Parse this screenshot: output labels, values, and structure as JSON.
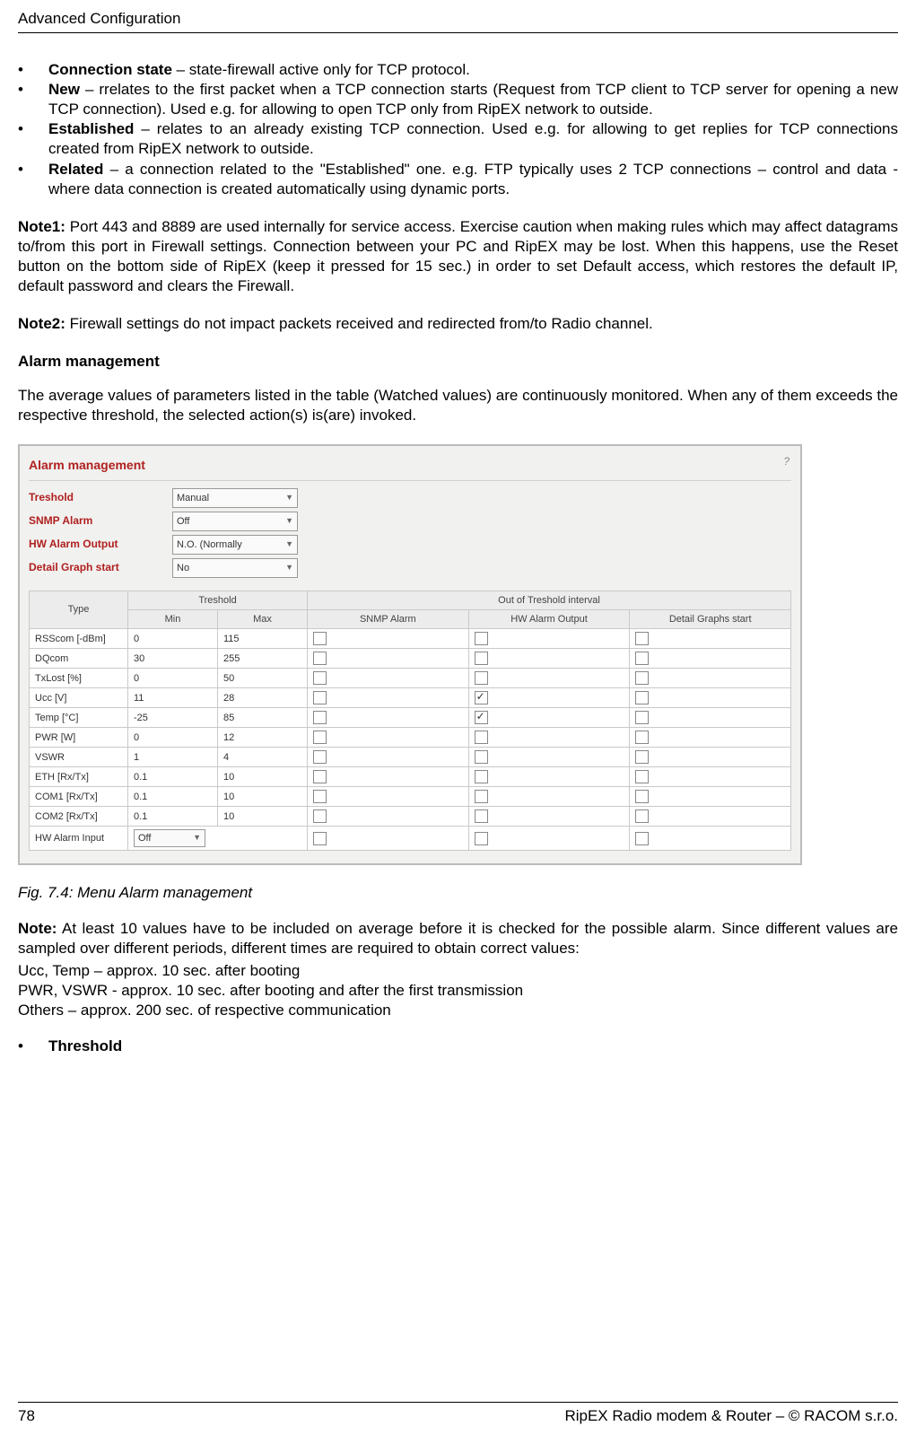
{
  "header": "Advanced Configuration",
  "bullets": [
    {
      "term": "Connection state",
      "desc": " – state-firewall active only for TCP protocol."
    },
    {
      "term": "New",
      "desc": " – rrelates to the first packet when a TCP connection starts (Request from TCP client to TCP server for opening a new TCP connection). Used e.g. for allowing to open TCP only from RipEX network to outside."
    },
    {
      "term": "Established",
      "desc": " – relates to an already existing TCP connection. Used e.g. for allowing to get replies for TCP connections created from RipEX network to outside."
    },
    {
      "term": "Related",
      "desc": " – a connection related to the \"Established\" one. e.g. FTP typically uses 2 TCP connections – control and data - where data connection is created automatically using dynamic ports."
    }
  ],
  "note1_label": "Note1:",
  "note1_text": " Port 443 and 8889 are used internally for service access. Exercise caution when making rules which may affect datagrams to/from this port in Firewall settings. Connection between your PC and RipEX may be lost. When this happens, use the Reset button on the bottom side of RipEX (keep it pressed for 15 sec.) in order to set Default access, which restores the default IP, default password and clears the Firewall.",
  "note2_label": "Note2:",
  "note2_text": " Firewall settings do not impact packets received and redirected from/to Radio channel.",
  "alarm_heading": "Alarm management",
  "alarm_intro": "The average values of parameters listed in the table (Watched values) are continuously monitored. When any of them exceeds the respective threshold, the selected action(s) is(are) invoked.",
  "panel": {
    "title": "Alarm management",
    "help": "?",
    "labels": {
      "treshold": "Treshold",
      "snmp": "SNMP Alarm",
      "hw": "HW Alarm Output",
      "detail": "Detail Graph start"
    },
    "selects": {
      "treshold": "Manual",
      "snmp": "Off",
      "hw": "N.O. (Normally",
      "detail": "No"
    },
    "thead": {
      "type": "Type",
      "treshold": "Treshold",
      "min": "Min",
      "max": "Max",
      "out": "Out of Treshold interval",
      "snmp": "SNMP Alarm",
      "hw": "HW Alarm Output",
      "detail": "Detail Graphs start"
    },
    "rows": [
      {
        "type": "RSScom [-dBm]",
        "min": "0",
        "max": "115",
        "snmp": false,
        "hw": false,
        "dg": false
      },
      {
        "type": "DQcom",
        "min": "30",
        "max": "255",
        "snmp": false,
        "hw": false,
        "dg": false
      },
      {
        "type": "TxLost [%]",
        "min": "0",
        "max": "50",
        "snmp": false,
        "hw": false,
        "dg": false
      },
      {
        "type": "Ucc [V]",
        "min": "11",
        "max": "28",
        "snmp": false,
        "hw": true,
        "dg": false
      },
      {
        "type": "Temp [°C]",
        "min": "-25",
        "max": "85",
        "snmp": false,
        "hw": true,
        "dg": false
      },
      {
        "type": "PWR [W]",
        "min": "0",
        "max": "12",
        "snmp": false,
        "hw": false,
        "dg": false
      },
      {
        "type": "VSWR",
        "min": "1",
        "max": "4",
        "snmp": false,
        "hw": false,
        "dg": false
      },
      {
        "type": "ETH [Rx/Tx]",
        "min": "0.1",
        "max": "10",
        "snmp": false,
        "hw": false,
        "dg": false
      },
      {
        "type": "COM1 [Rx/Tx]",
        "min": "0.1",
        "max": "10",
        "snmp": false,
        "hw": false,
        "dg": false
      },
      {
        "type": "COM2 [Rx/Tx]",
        "min": "0.1",
        "max": "10",
        "snmp": false,
        "hw": false,
        "dg": false
      }
    ],
    "last_row": {
      "type": "HW Alarm Input",
      "select": "Off"
    }
  },
  "fig_caption": "Fig. 7.4: Menu Alarm management",
  "note_label": "Note:",
  "note_text": " At least 10 values have to be included on average before it is checked for the possible alarm. Since different values are sampled over different periods, different times are required to obtain correct values:",
  "note_lines": [
    "Ucc, Temp – approx. 10 sec. after booting",
    "PWR, VSWR - approx. 10 sec. after booting and after the first transmission",
    "Others – approx. 200 sec. of respective communication"
  ],
  "threshold_bullet": "Threshold",
  "footer": {
    "page": "78",
    "right": "RipEX Radio modem & Router – © RACOM s.r.o."
  }
}
